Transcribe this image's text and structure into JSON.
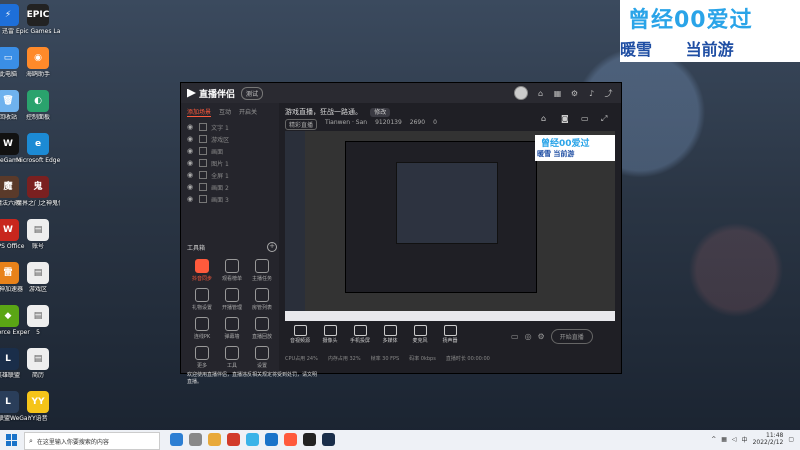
{
  "desktop_icons": [
    {
      "name": "thunder-icon",
      "label": "迅雷",
      "color": "#1e6fd9",
      "glyph": "⚡"
    },
    {
      "name": "epic-games-icon",
      "label": "Epic Games Launcher",
      "color": "#222",
      "glyph": "EPIC"
    },
    {
      "name": "pc-icon",
      "label": "此电脑",
      "color": "#3a8ee6",
      "glyph": "▭"
    },
    {
      "name": "helper-icon",
      "label": "海鸥助手",
      "color": "#ff8a2a",
      "glyph": "◉"
    },
    {
      "name": "ie-icon",
      "label": "回收站",
      "color": "#6fb2ee",
      "glyph": "🗑"
    },
    {
      "name": "edge-icon",
      "label": "控制面板",
      "color": "#2aa36d",
      "glyph": "◐"
    },
    {
      "name": "wegame-icon",
      "label": "WeGame",
      "color": "#111",
      "glyph": "W"
    },
    {
      "name": "edge-browser-icon",
      "label": "Microsoft Edge",
      "color": "#1c8ad4",
      "glyph": "e"
    },
    {
      "name": "game1-icon",
      "label": "魔法六阀",
      "color": "#5a3a2a",
      "glyph": "魔"
    },
    {
      "name": "game2-icon",
      "label": "魔界之门之神鬼传奇",
      "color": "#7a2020",
      "glyph": "鬼"
    },
    {
      "name": "wps-icon",
      "label": "WPS Office",
      "color": "#c8261d",
      "glyph": "W"
    },
    {
      "name": "doc-icon",
      "label": "账号",
      "color": "#eee",
      "glyph": "▤"
    },
    {
      "name": "tool-icon",
      "label": "雷神加速器",
      "color": "#e8821a",
      "glyph": "雷"
    },
    {
      "name": "doc2-icon",
      "label": "游戏区",
      "color": "#eee",
      "glyph": "▤"
    },
    {
      "name": "geforce-icon",
      "label": "GeForce Experience",
      "color": "#5aa615",
      "glyph": "◆"
    },
    {
      "name": "doc3-icon",
      "label": "5",
      "color": "#eee",
      "glyph": "▤"
    },
    {
      "name": "lol-icon",
      "label": "英雄联盟",
      "color": "#1a2e4a",
      "glyph": "L"
    },
    {
      "name": "doc4-icon",
      "label": "简历",
      "color": "#eee",
      "glyph": "▤"
    },
    {
      "name": "lol-wegame-icon",
      "label": "英雄联盟WeGame版",
      "color": "#2a3e5a",
      "glyph": "L"
    },
    {
      "name": "yy-icon",
      "label": "YY语音",
      "color": "#f5c419",
      "glyph": "YY"
    }
  ],
  "banner": {
    "line1": "曾经00爱过",
    "line2a": "暖雪",
    "line2b": "当前游"
  },
  "app": {
    "title": "直播伴侣",
    "version": "测试",
    "tabs": [
      "添加场景",
      "互动",
      "开启关"
    ],
    "scenes": [
      "文字 1",
      "游戏区",
      "画面",
      "图片 1",
      "全屏 1",
      "画面 2",
      "画面 3"
    ],
    "tools_title": "工具箱",
    "tools": [
      {
        "name": "hot",
        "label": "抖音同步",
        "hot": true
      },
      {
        "name": "user",
        "label": "观看榜单"
      },
      {
        "name": "qa",
        "label": "主播任务"
      },
      {
        "name": "gift",
        "label": "礼物设置"
      },
      {
        "name": "data",
        "label": "开播管理"
      },
      {
        "name": "mic",
        "label": "房管列表"
      },
      {
        "name": "pk",
        "label": "连线PK"
      },
      {
        "name": "msg",
        "label": "弹幕墙"
      },
      {
        "name": "mark",
        "label": "直播回放"
      },
      {
        "name": "plus",
        "label": "更多"
      },
      {
        "name": "plus2",
        "label": "工具"
      },
      {
        "name": "plus3",
        "label": "设置"
      }
    ],
    "topic": "游戏直播，狂战一路通。",
    "topic_mod": "修改",
    "stats": [
      "Tianwen · San",
      "9120139",
      "2690",
      "0"
    ],
    "stream_tag": "精彩直播",
    "bottom_buttons": [
      "音视频源",
      "摄像头",
      "手机投屏",
      "多媒体",
      "麦克风",
      "扬声器"
    ],
    "live_button": "开始直播",
    "status": [
      "CPU占用 24%",
      "内存占用 32%",
      "帧率 30 FPS",
      "码率 0kbps",
      "直播时长 00:00:00"
    ],
    "notice": "欢迎使用直播伴侣，直播违反相关规定将受到处罚，请文明直播。"
  },
  "mini_banner": {
    "a": "曾经00爱过",
    "b": "暖雪  当前游"
  },
  "taskbar": {
    "search_placeholder": "在这里输入你要搜索的内容",
    "time": "11:48",
    "date": "2022/2/12",
    "ime": "中"
  }
}
